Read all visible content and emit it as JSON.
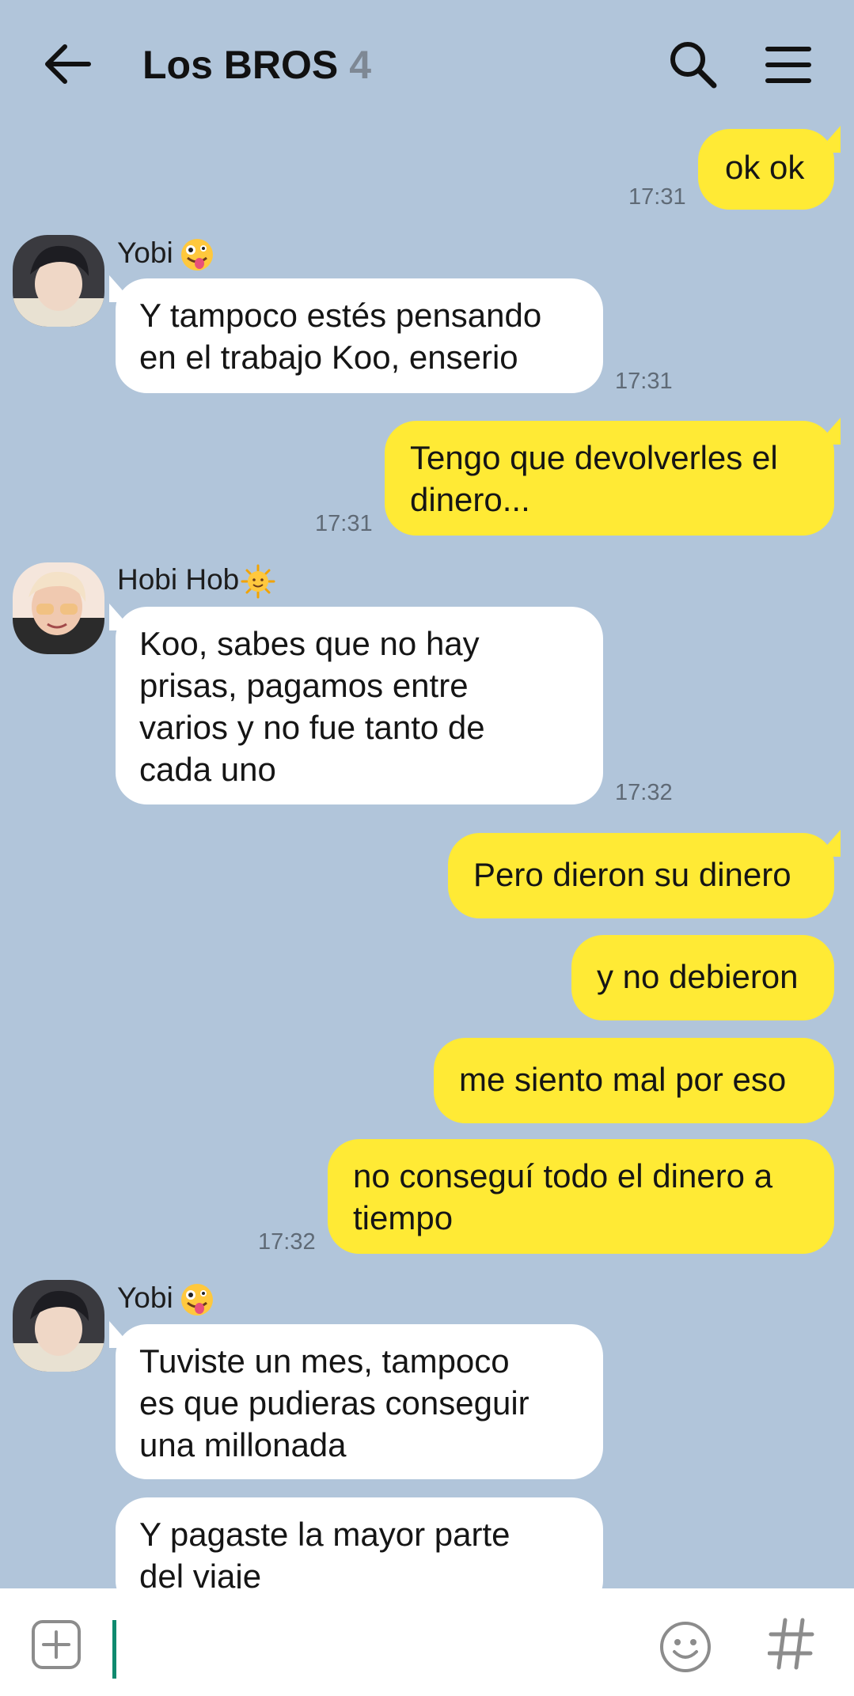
{
  "header": {
    "title": "Los BROS",
    "member_count": "4"
  },
  "messages": [
    {
      "from": "me",
      "lines": [
        "ok ok"
      ],
      "time": "17:31"
    },
    {
      "from": "Yobi",
      "sender_label": "Yobi",
      "sender_emoji": "zany-face",
      "lines": [
        "Y tampoco estés pensando",
        "en el trabajo Koo, enserio"
      ],
      "time": "17:31"
    },
    {
      "from": "me",
      "lines": [
        "Tengo que devolverles el",
        "dinero..."
      ],
      "time": "17:31"
    },
    {
      "from": "Hobi Hob",
      "sender_label": "Hobi Hob",
      "sender_emoji": "sun-with-face",
      "lines": [
        "Koo, sabes que no hay",
        "prisas, pagamos entre",
        "varios y no fue tanto de",
        "cada uno"
      ],
      "time": "17:32"
    },
    {
      "from": "me",
      "lines": [
        "Pero dieron su dinero"
      ]
    },
    {
      "from": "me",
      "lines": [
        "y no debieron"
      ]
    },
    {
      "from": "me",
      "lines": [
        "me siento mal por eso"
      ]
    },
    {
      "from": "me",
      "lines": [
        "no conseguí todo el dinero a",
        "tiempo"
      ],
      "time": "17:32"
    },
    {
      "from": "Yobi",
      "sender_label": "Yobi",
      "sender_emoji": "zany-face",
      "lines": [
        "Tuviste un mes, tampoco",
        "es que pudieras conseguir",
        "una millonada"
      ]
    },
    {
      "from": "Yobi",
      "lines": [
        "Y pagaste la mayor parte",
        "del viaje"
      ]
    }
  ],
  "input": {
    "value": ""
  },
  "colors": {
    "background": "#b1c5da",
    "my_bubble": "#ffea35",
    "their_bubble": "#ffffff",
    "cursor": "#0f8a6f"
  }
}
